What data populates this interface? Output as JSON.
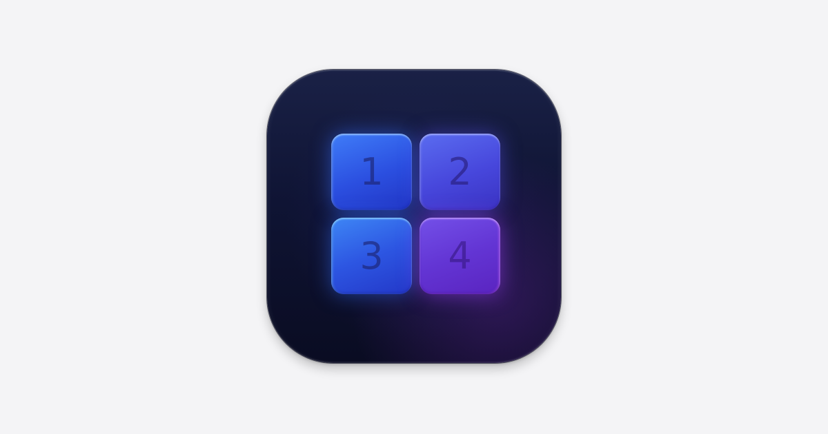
{
  "app_icon": {
    "name": "number-grid-app-icon",
    "tiles": [
      {
        "label": "1",
        "color": "#2b4fe0"
      },
      {
        "label": "2",
        "color": "#4747dc"
      },
      {
        "label": "3",
        "color": "#2d56e2"
      },
      {
        "label": "4",
        "color": "#6335d4"
      }
    ]
  },
  "colors": {
    "page_background": "#f4f4f6",
    "icon_background": "#0f1434"
  }
}
